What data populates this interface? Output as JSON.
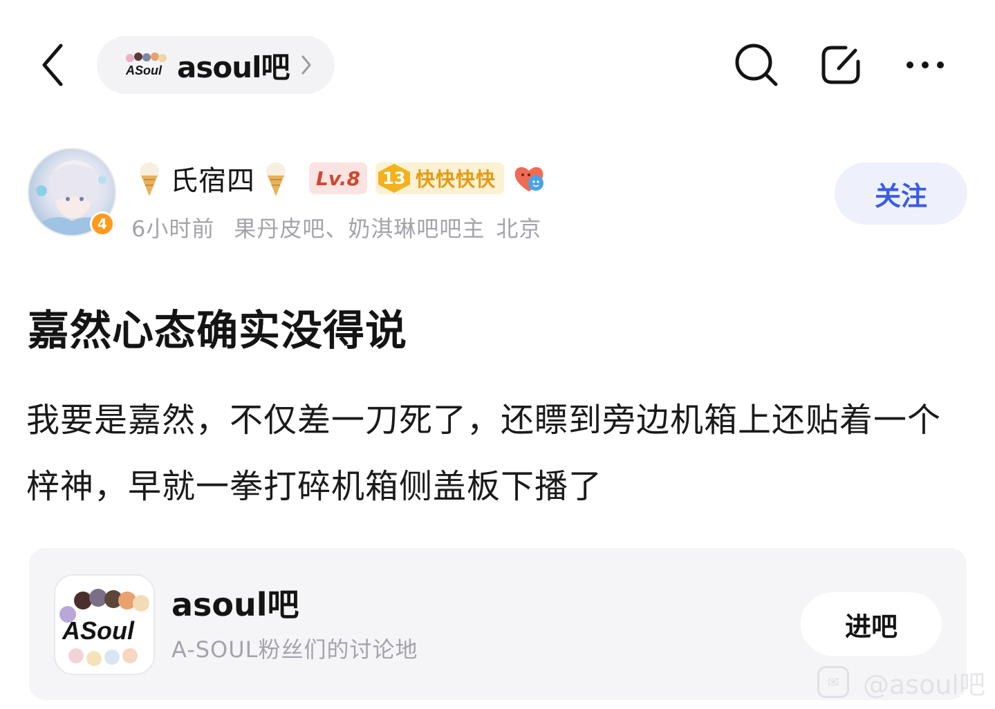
{
  "topbar": {
    "forum_name": "asoul吧",
    "logo_text": "ASoul",
    "icons": [
      "back-icon",
      "chevron-right-icon",
      "search-icon",
      "edit-icon",
      "more-icon"
    ]
  },
  "author": {
    "name": "氏宿四",
    "level": "Lv.8",
    "fan_level": "13",
    "fan_title": "快快快快",
    "avatar_badge": "4",
    "time": "6小时前",
    "roles": "果丹皮吧、奶淇琳吧吧主",
    "location": "北京",
    "follow_label": "关注"
  },
  "post": {
    "title": "嘉然心态确实没得说",
    "body": "我要是嘉然，不仅差一刀死了，还瞟到旁边机箱上还贴着一个梓神，早就一拳打碎机箱侧盖板下播了"
  },
  "forum_card": {
    "name": "asoul吧",
    "description": "A-SOUL粉丝们的讨论地",
    "logo_text": "ASoul",
    "enter_label": "进吧"
  },
  "watermark": {
    "text": "@asoul吧"
  },
  "colors": {
    "accent_blue": "#3a5be8",
    "follow_bg": "#eef1fc",
    "card_bg": "#f5f5f8",
    "level_red": "#d2452f",
    "fan_gold": "#e59a14"
  }
}
